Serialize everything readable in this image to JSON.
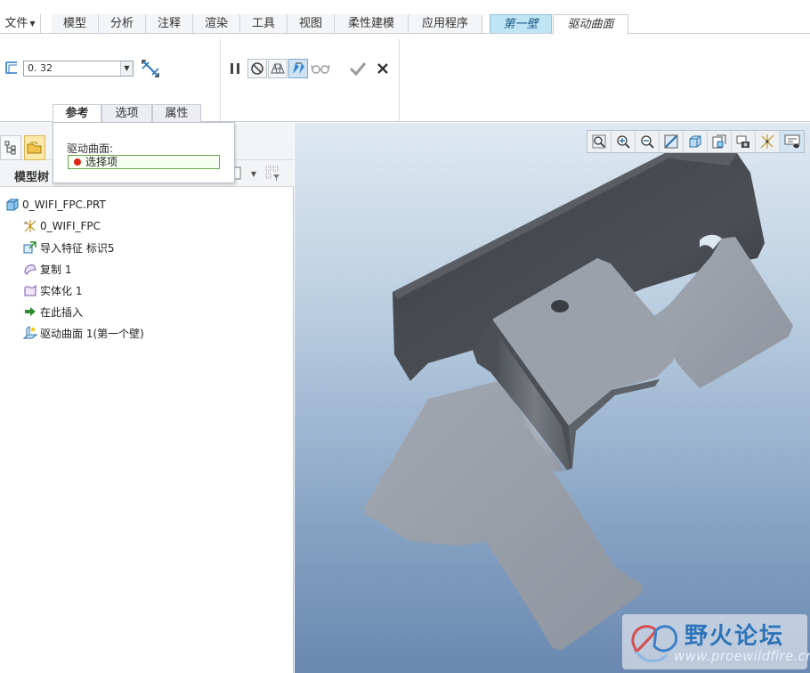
{
  "menu": {
    "file": "文件",
    "tabs": [
      "模型",
      "分析",
      "注释",
      "渲染",
      "工具",
      "视图",
      "柔性建模",
      "应用程序"
    ],
    "context_tab": "第一壁",
    "active_tab": "驱动曲面"
  },
  "ribbon": {
    "thickness_value": "0. 32"
  },
  "subtabs": [
    "参考",
    "选项",
    "属性"
  ],
  "panel": {
    "label": "驱动曲面:",
    "collector": "选择项"
  },
  "model_tree": {
    "title": "模型树",
    "items": [
      {
        "label": "0_WIFI_FPC.PRT",
        "icon": "part-icon"
      },
      {
        "label": "0_WIFI_FPC",
        "icon": "csys-icon"
      },
      {
        "label": "导入特征 标识5",
        "icon": "import-feature-icon"
      },
      {
        "label": "复制 1",
        "icon": "copy-icon"
      },
      {
        "label": "实体化 1",
        "icon": "solidify-icon"
      },
      {
        "label": "在此插入",
        "icon": "insert-here-arrow-icon"
      },
      {
        "label": "驱动曲面 1(第一个壁)",
        "icon": "sheetmetal-wall-icon"
      }
    ]
  },
  "watermark": {
    "title": "野火论坛",
    "url": "www.proewildfire.cn"
  },
  "colors": {
    "accent": "#2e74b8",
    "context_tab_bg": "#bfe4f4",
    "active_node_bg": "#fce9a8",
    "model_dark": "#45484d",
    "model_light": "#9da3ad"
  }
}
